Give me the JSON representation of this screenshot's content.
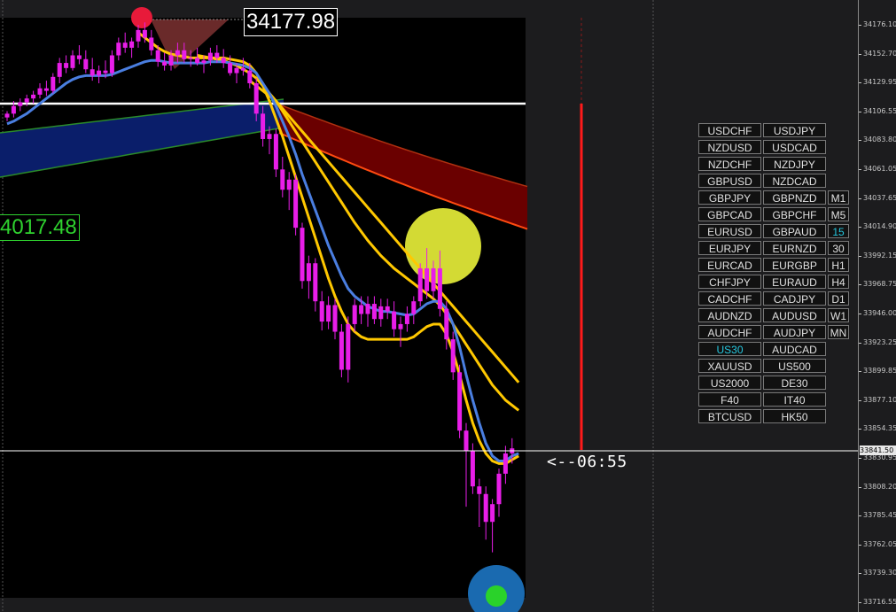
{
  "chart_data": {
    "type": "candlestick",
    "symbol": "US30",
    "y_ticks": [
      "34176.10",
      "34152.70",
      "34129.95",
      "34106.55",
      "34083.80",
      "34061.05",
      "34037.65",
      "34014.90",
      "33992.15",
      "33968.75",
      "33946.00",
      "33923.25",
      "33899.85",
      "33877.10",
      "33854.35",
      "33830.95",
      "33808.20",
      "33785.45",
      "33762.05",
      "33739.30",
      "33716.55"
    ],
    "current_price": "33841.50",
    "high_label": "34177.98",
    "left_label": "4017.48",
    "countdown": "<--06:55",
    "horizontal_level": 34110,
    "candles": [
      {
        "o": 34103,
        "h": 34108,
        "l": 34100,
        "c": 34106
      },
      {
        "o": 34106,
        "h": 34116,
        "l": 34103,
        "c": 34112
      },
      {
        "o": 34112,
        "h": 34118,
        "l": 34108,
        "c": 34115
      },
      {
        "o": 34115,
        "h": 34121,
        "l": 34112,
        "c": 34118
      },
      {
        "o": 34118,
        "h": 34124,
        "l": 34114,
        "c": 34121
      },
      {
        "o": 34121,
        "h": 34130,
        "l": 34118,
        "c": 34126
      },
      {
        "o": 34126,
        "h": 34132,
        "l": 34120,
        "c": 34124
      },
      {
        "o": 34124,
        "h": 34138,
        "l": 34122,
        "c": 34135
      },
      {
        "o": 34135,
        "h": 34150,
        "l": 34130,
        "c": 34146
      },
      {
        "o": 34146,
        "h": 34152,
        "l": 34138,
        "c": 34142
      },
      {
        "o": 34142,
        "h": 34156,
        "l": 34140,
        "c": 34152
      },
      {
        "o": 34152,
        "h": 34160,
        "l": 34145,
        "c": 34149
      },
      {
        "o": 34149,
        "h": 34156,
        "l": 34138,
        "c": 34141
      },
      {
        "o": 34141,
        "h": 34150,
        "l": 34132,
        "c": 34136
      },
      {
        "o": 34136,
        "h": 34144,
        "l": 34130,
        "c": 34140
      },
      {
        "o": 34140,
        "h": 34148,
        "l": 34134,
        "c": 34138
      },
      {
        "o": 34138,
        "h": 34156,
        "l": 34135,
        "c": 34152
      },
      {
        "o": 34152,
        "h": 34166,
        "l": 34148,
        "c": 34162
      },
      {
        "o": 34162,
        "h": 34170,
        "l": 34154,
        "c": 34158
      },
      {
        "o": 34158,
        "h": 34166,
        "l": 34150,
        "c": 34163
      },
      {
        "o": 34163,
        "h": 34176,
        "l": 34158,
        "c": 34172
      },
      {
        "o": 34172,
        "h": 34178,
        "l": 34162,
        "c": 34166
      },
      {
        "o": 34166,
        "h": 34172,
        "l": 34152,
        "c": 34156
      },
      {
        "o": 34156,
        "h": 34160,
        "l": 34143,
        "c": 34147
      },
      {
        "o": 34147,
        "h": 34154,
        "l": 34140,
        "c": 34144
      },
      {
        "o": 34144,
        "h": 34156,
        "l": 34140,
        "c": 34152
      },
      {
        "o": 34152,
        "h": 34162,
        "l": 34146,
        "c": 34156
      },
      {
        "o": 34156,
        "h": 34162,
        "l": 34146,
        "c": 34149
      },
      {
        "o": 34149,
        "h": 34156,
        "l": 34143,
        "c": 34150
      },
      {
        "o": 34150,
        "h": 34158,
        "l": 34144,
        "c": 34146
      },
      {
        "o": 34146,
        "h": 34152,
        "l": 34138,
        "c": 34148
      },
      {
        "o": 34148,
        "h": 34158,
        "l": 34144,
        "c": 34154
      },
      {
        "o": 34154,
        "h": 34160,
        "l": 34146,
        "c": 34150
      },
      {
        "o": 34150,
        "h": 34157,
        "l": 34142,
        "c": 34146
      },
      {
        "o": 34146,
        "h": 34152,
        "l": 34136,
        "c": 34138
      },
      {
        "o": 34138,
        "h": 34146,
        "l": 34130,
        "c": 34142
      },
      {
        "o": 34142,
        "h": 34150,
        "l": 34136,
        "c": 34140
      },
      {
        "o": 34140,
        "h": 34146,
        "l": 34126,
        "c": 34130
      },
      {
        "o": 34130,
        "h": 34134,
        "l": 34100,
        "c": 34106
      },
      {
        "o": 34106,
        "h": 34112,
        "l": 34080,
        "c": 34086
      },
      {
        "o": 34086,
        "h": 34096,
        "l": 34074,
        "c": 34090
      },
      {
        "o": 34090,
        "h": 34094,
        "l": 34056,
        "c": 34062
      },
      {
        "o": 34062,
        "h": 34072,
        "l": 34040,
        "c": 34046
      },
      {
        "o": 34046,
        "h": 34060,
        "l": 34030,
        "c": 34054
      },
      {
        "o": 34054,
        "h": 34058,
        "l": 34010,
        "c": 34016
      },
      {
        "o": 34016,
        "h": 34020,
        "l": 33968,
        "c": 33974
      },
      {
        "o": 33974,
        "h": 33994,
        "l": 33960,
        "c": 33988
      },
      {
        "o": 33988,
        "h": 33992,
        "l": 33950,
        "c": 33958
      },
      {
        "o": 33958,
        "h": 33966,
        "l": 33935,
        "c": 33942
      },
      {
        "o": 33942,
        "h": 33962,
        "l": 33936,
        "c": 33955
      },
      {
        "o": 33955,
        "h": 33960,
        "l": 33928,
        "c": 33934
      },
      {
        "o": 33934,
        "h": 33940,
        "l": 33898,
        "c": 33904
      },
      {
        "o": 33904,
        "h": 33946,
        "l": 33894,
        "c": 33940
      },
      {
        "o": 33940,
        "h": 33960,
        "l": 33934,
        "c": 33955
      },
      {
        "o": 33955,
        "h": 33962,
        "l": 33940,
        "c": 33948
      },
      {
        "o": 33948,
        "h": 33962,
        "l": 33938,
        "c": 33956
      },
      {
        "o": 33956,
        "h": 33962,
        "l": 33940,
        "c": 33944
      },
      {
        "o": 33944,
        "h": 33960,
        "l": 33938,
        "c": 33954
      },
      {
        "o": 33954,
        "h": 33960,
        "l": 33944,
        "c": 33950
      },
      {
        "o": 33950,
        "h": 33958,
        "l": 33930,
        "c": 33936
      },
      {
        "o": 33936,
        "h": 33946,
        "l": 33922,
        "c": 33940
      },
      {
        "o": 33940,
        "h": 33954,
        "l": 33934,
        "c": 33948
      },
      {
        "o": 33948,
        "h": 33962,
        "l": 33940,
        "c": 33958
      },
      {
        "o": 33958,
        "h": 33988,
        "l": 33954,
        "c": 33984
      },
      {
        "o": 33984,
        "h": 34000,
        "l": 33960,
        "c": 33966
      },
      {
        "o": 33966,
        "h": 33990,
        "l": 33960,
        "c": 33984
      },
      {
        "o": 33984,
        "h": 33998,
        "l": 33946,
        "c": 33952
      },
      {
        "o": 33952,
        "h": 33958,
        "l": 33920,
        "c": 33928
      },
      {
        "o": 33928,
        "h": 33934,
        "l": 33896,
        "c": 33902
      },
      {
        "o": 33902,
        "h": 33908,
        "l": 33850,
        "c": 33856
      },
      {
        "o": 33856,
        "h": 33862,
        "l": 33796,
        "c": 33840
      },
      {
        "o": 33840,
        "h": 33846,
        "l": 33806,
        "c": 33812
      },
      {
        "o": 33812,
        "h": 33818,
        "l": 33780,
        "c": 33806
      },
      {
        "o": 33806,
        "h": 33812,
        "l": 33770,
        "c": 33784
      },
      {
        "o": 33784,
        "h": 33802,
        "l": 33760,
        "c": 33798
      },
      {
        "o": 33798,
        "h": 33826,
        "l": 33788,
        "c": 33822
      },
      {
        "o": 33822,
        "h": 33844,
        "l": 33814,
        "c": 33838
      },
      {
        "o": 33838,
        "h": 33850,
        "l": 33830,
        "c": 33842
      }
    ],
    "ma_fast": [
      34098,
      34100,
      34103,
      34106,
      34110,
      34114,
      34118,
      34122,
      34126,
      34130,
      34133,
      34135,
      34136,
      34136,
      34136,
      34136,
      34137,
      34139,
      34141,
      34143,
      34145,
      34147,
      34148,
      34148,
      34147,
      34146,
      34146,
      34146,
      34146,
      34146,
      34146,
      34147,
      34147,
      34147,
      34146,
      34145,
      34144,
      34142,
      34138,
      34130,
      34122,
      34112,
      34100,
      34088,
      34074,
      34058,
      34044,
      34030,
      34016,
      34002,
      33990,
      33978,
      33968,
      33962,
      33958,
      33954,
      33952,
      33950,
      33950,
      33949,
      33948,
      33947,
      33948,
      33952,
      33956,
      33958,
      33958,
      33952,
      33940,
      33922,
      33900,
      33880,
      33862,
      33846,
      33836,
      33832,
      33832,
      33836,
      33838
    ],
    "ma_yellow_1": [
      null,
      null,
      null,
      null,
      null,
      null,
      null,
      null,
      null,
      null,
      null,
      null,
      null,
      null,
      null,
      null,
      null,
      null,
      null,
      null,
      34170,
      34166,
      34162,
      34158,
      34155,
      34153,
      34152,
      34151,
      34150,
      34150,
      34150,
      34150,
      34150,
      34150,
      34149,
      34148,
      34147,
      34144,
      34138,
      34128,
      34116,
      34102,
      34088,
      34072,
      34056,
      34040,
      34024,
      34008,
      33992,
      33976,
      33962,
      33950,
      33940,
      33934,
      33930,
      33928,
      33928,
      33928,
      33928,
      33928,
      33928,
      33928,
      33930,
      33934,
      33938,
      33940,
      33940,
      33932,
      33918,
      33900,
      33880,
      33862,
      33848,
      33838,
      33832,
      33830,
      33830,
      33833,
      33836
    ],
    "ma_yellow_2": [
      null,
      null,
      null,
      null,
      null,
      null,
      null,
      null,
      null,
      null,
      null,
      null,
      null,
      null,
      null,
      null,
      null,
      null,
      null,
      null,
      null,
      null,
      null,
      null,
      null,
      null,
      null,
      null,
      null,
      34152,
      34151,
      34150,
      34149,
      34148,
      34146,
      34144,
      34141,
      34138,
      34134,
      34128,
      34122,
      34116,
      34108,
      34100,
      34092,
      34084,
      34076,
      34068,
      34060,
      34052,
      34044,
      34036,
      34028,
      34020,
      34013,
      34006,
      34000,
      33994,
      33989,
      33984,
      33980,
      33976,
      33972,
      33968,
      33964,
      33960,
      33955,
      33948,
      33940,
      33932,
      33924,
      33916,
      33908,
      33900,
      33892,
      33886,
      33880,
      33876,
      33872
    ],
    "ma_yellow_3": [
      null,
      null,
      null,
      null,
      null,
      null,
      null,
      null,
      null,
      null,
      null,
      null,
      null,
      null,
      null,
      null,
      null,
      null,
      null,
      null,
      null,
      null,
      null,
      null,
      null,
      null,
      null,
      null,
      null,
      null,
      null,
      null,
      null,
      null,
      null,
      null,
      null,
      34132,
      34128,
      34124,
      34120,
      34116,
      34110,
      34104,
      34098,
      34092,
      34086,
      34080,
      34074,
      34068,
      34062,
      34056,
      34050,
      34044,
      34038,
      34032,
      34026,
      34020,
      34014,
      34008,
      34002,
      33996,
      33990,
      33984,
      33978,
      33972,
      33966,
      33960,
      33954,
      33948,
      33942,
      33936,
      33930,
      33924,
      33918,
      33912,
      33906,
      33900,
      33894
    ]
  },
  "symbols_left": [
    "USDCHF",
    "NZDUSD",
    "NZDCHF",
    "GBPUSD",
    "GBPJPY",
    "GBPCAD",
    "EURUSD",
    "EURJPY",
    "EURCAD",
    "CHFJPY",
    "CADCHF",
    "AUDNZD",
    "AUDCHF",
    "US30",
    "XAUUSD",
    "US2000",
    "F40",
    "BTCUSD"
  ],
  "symbols_right": [
    "USDJPY",
    "USDCAD",
    "NZDJPY",
    "NZDCAD",
    "GBPNZD",
    "GBPCHF",
    "GBPAUD",
    "EURNZD",
    "EURGBP",
    "EURAUD",
    "CADJPY",
    "AUDUSD",
    "AUDJPY",
    "AUDCAD",
    "US500",
    "DE30",
    "IT40",
    "HK50"
  ],
  "timeframes": [
    "M1",
    "M5",
    "15",
    "30",
    "H1",
    "H4",
    "D1",
    "W1",
    "MN"
  ],
  "active_symbol": "US30",
  "active_timeframe": "15",
  "colors": {
    "candle": "#e81ee8",
    "ma_blue": "#4a7ee0",
    "ma_yellow": "#ffc800",
    "band_dark_red": "#6a0000",
    "band_navy": "#0a1e6a",
    "red_vline": "#ff1a1a",
    "green_label": "#2fd22f",
    "accent": "#25c8e0"
  }
}
